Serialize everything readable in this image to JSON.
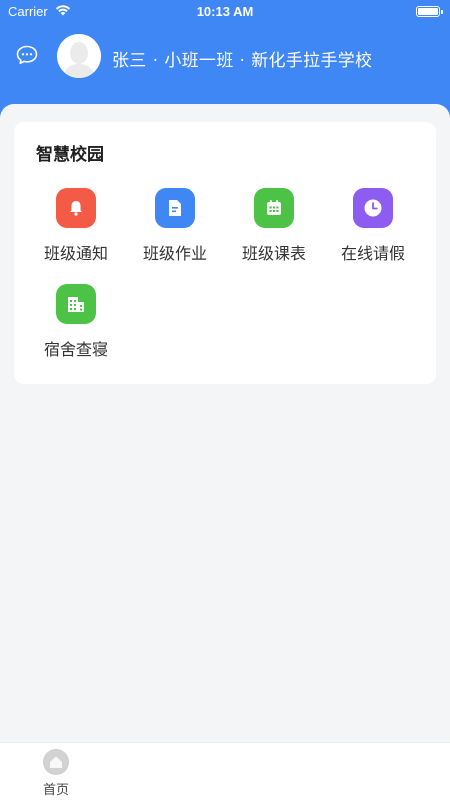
{
  "status_bar": {
    "carrier": "Carrier",
    "time": "10:13 AM"
  },
  "header": {
    "student_name": "张三",
    "class_name": "小班一班",
    "school_name": "新化手拉手学校",
    "separator": "·",
    "bg_color": "#3f87f5"
  },
  "smart_campus": {
    "title": "智慧校园",
    "items": [
      {
        "label": "班级通知",
        "icon": "bell-icon",
        "color": "#f45b46"
      },
      {
        "label": "班级作业",
        "icon": "document-icon",
        "color": "#3f87f5"
      },
      {
        "label": "班级课表",
        "icon": "calendar-icon",
        "color": "#4cc347"
      },
      {
        "label": "在线请假",
        "icon": "clock-icon",
        "color": "#8d5cf0"
      },
      {
        "label": "宿舍查寝",
        "icon": "building-icon",
        "color": "#4cc347"
      }
    ]
  },
  "tabbar": {
    "home_label": "首页",
    "home_icon": "home-icon"
  }
}
